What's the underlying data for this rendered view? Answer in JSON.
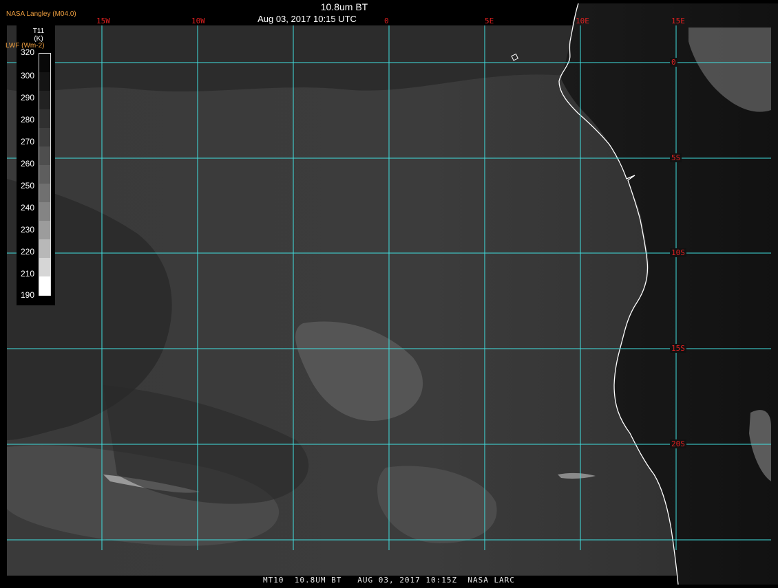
{
  "header": {
    "title": "10.8um BT",
    "datetime": "Aug 03, 2017 10:15 UTC",
    "credit": "NASA Langley (M04.0)",
    "product": "LWF (Wm-2)"
  },
  "footer": {
    "caption": "MT10  10.8UM BT   AUG 03, 2017 10:15Z  NASA LARC"
  },
  "legend": {
    "title_line1": "T11",
    "title_line2": "(K)",
    "ticks": [
      "320",
      "300",
      "290",
      "280",
      "270",
      "260",
      "250",
      "240",
      "230",
      "220",
      "210",
      "190"
    ]
  },
  "grid": {
    "lon_labels": [
      "15W",
      "10W",
      "0",
      "5E",
      "10E",
      "15E"
    ],
    "lat_labels": [
      "0",
      "5S",
      "10S",
      "15S",
      "20S"
    ]
  },
  "colors": {
    "grid_line": "#40e0e0",
    "grid_label": "#e02020",
    "coastline": "#ffffff",
    "header_credit": "#f0a040"
  },
  "icons": {
    "coastline": "coastline-icon"
  }
}
